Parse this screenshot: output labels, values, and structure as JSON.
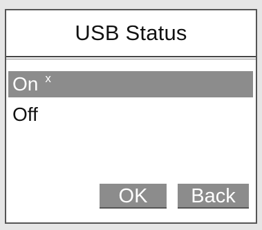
{
  "dialog": {
    "title": "USB Status"
  },
  "options": [
    {
      "label": "On",
      "mark": "x",
      "selected": true
    },
    {
      "label": "Off",
      "mark": "",
      "selected": false
    }
  ],
  "buttons": {
    "ok_label": "OK",
    "back_label": "Back"
  },
  "colors": {
    "selection": "#8c8c8c",
    "background": "#ffffff",
    "frame": "#e6e6e6"
  }
}
